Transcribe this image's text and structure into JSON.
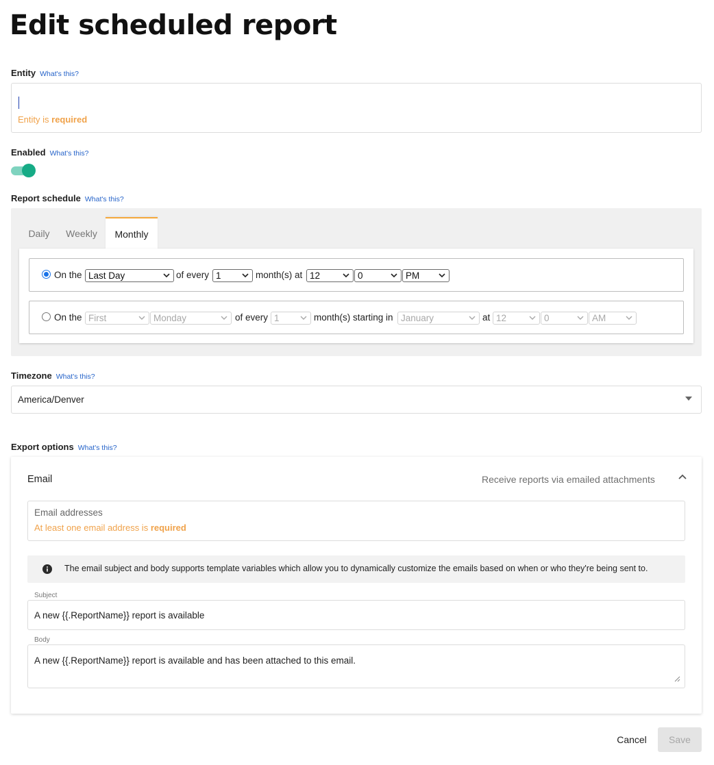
{
  "page": {
    "title": "Edit scheduled report"
  },
  "help_text": "What's this?",
  "entity": {
    "label": "Entity",
    "error_prefix": "Entity is",
    "error_emph": "required"
  },
  "enabled": {
    "label": "Enabled",
    "on": true
  },
  "schedule": {
    "label": "Report schedule",
    "tabs": [
      "Daily",
      "Weekly",
      "Monthly"
    ],
    "active_tab": "Monthly",
    "option1": {
      "selected": true,
      "on_the": "On the",
      "day": "Last Day",
      "of_every": "of every",
      "interval": "1",
      "months_at": "month(s) at",
      "hour": "12",
      "minute": "0",
      "ampm": "PM"
    },
    "option2": {
      "selected": false,
      "on_the": "On the",
      "ordinal": "First",
      "weekday": "Monday",
      "of_every": "of every",
      "interval": "1",
      "months_starting": "month(s) starting in",
      "month": "January",
      "at": "at",
      "hour": "12",
      "minute": "0",
      "ampm": "AM"
    }
  },
  "timezone": {
    "label": "Timezone",
    "value": "America/Denver"
  },
  "export": {
    "label": "Export options",
    "email": {
      "title": "Email",
      "description": "Receive reports via emailed attachments",
      "addresses_placeholder": "Email addresses",
      "addresses_error_prefix": "At least one email address is",
      "addresses_error_emph": "required",
      "info": "The email subject and body supports template variables which allow you to dynamically customize the emails based on when or who they're being sent to.",
      "subject_label": "Subject",
      "subject_value": "A new {{.ReportName}} report is available",
      "body_label": "Body",
      "body_value": "A new {{.ReportName}} report is available and has been attached to this email."
    }
  },
  "actions": {
    "cancel": "Cancel",
    "save": "Save"
  },
  "colors": {
    "accent_orange": "#f5a83a",
    "error_orange": "#f0a24a",
    "toggle_green": "#16ab86",
    "link_blue": "#2563c9",
    "radio_blue": "#1a73e8"
  }
}
